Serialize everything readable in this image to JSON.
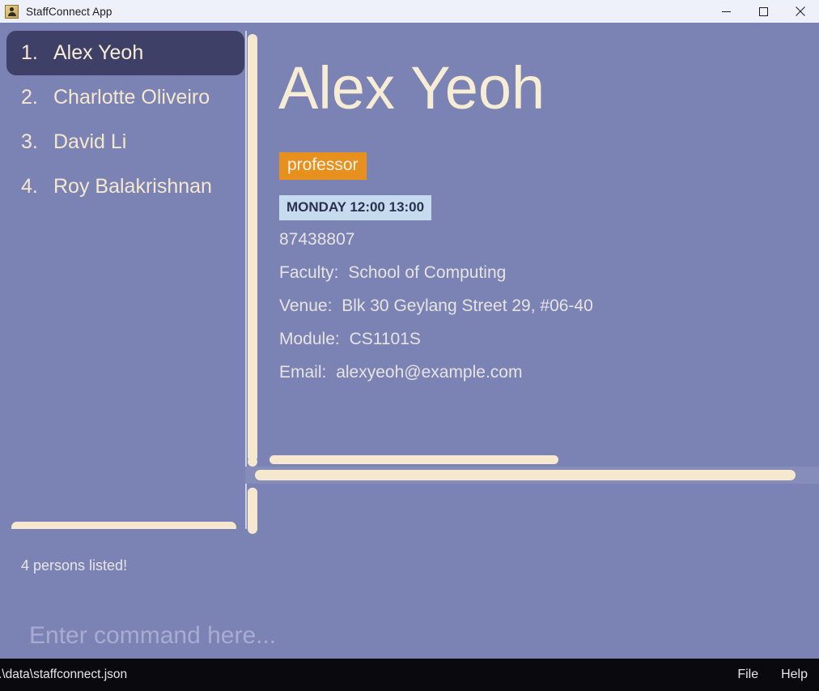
{
  "window": {
    "title": "StaffConnect App",
    "icon": "person-app-icon",
    "minimize_label": "Minimize",
    "maximize_label": "Maximize",
    "close_label": "Close"
  },
  "colors": {
    "background": "#7b82b4",
    "selected_item": "#3e4068",
    "accent_cream": "#f5e8cf",
    "tag_orange": "#e8901e",
    "schedule_blue": "#c6dcee",
    "statusbar": "#0a0a0e"
  },
  "person_list": {
    "items": [
      {
        "index": "1.",
        "name": "Alex Yeoh",
        "selected": true
      },
      {
        "index": "2.",
        "name": "Charlotte Oliveiro",
        "selected": false
      },
      {
        "index": "3.",
        "name": "David Li",
        "selected": false
      },
      {
        "index": "4.",
        "name": "Roy Balakrishnan",
        "selected": false
      }
    ]
  },
  "detail": {
    "name": "Alex Yeoh",
    "tag": "professor",
    "schedule": "MONDAY 12:00 13:00",
    "phone": "87438807",
    "faculty_label": "Faculty:",
    "faculty_value": "School of Computing",
    "venue_label": "Venue:",
    "venue_value": "Blk 30 Geylang Street 29, #06-40",
    "module_label": "Module:",
    "module_value": "CS1101S",
    "email_label": "Email:",
    "email_value": "alexyeoh@example.com"
  },
  "result_display": {
    "message": "4 persons listed!"
  },
  "command_box": {
    "value": "",
    "placeholder": "Enter command here..."
  },
  "status_bar": {
    "save_location": ".\\data\\staffconnect.json",
    "menu": [
      {
        "label": "File"
      },
      {
        "label": "Help"
      }
    ]
  }
}
